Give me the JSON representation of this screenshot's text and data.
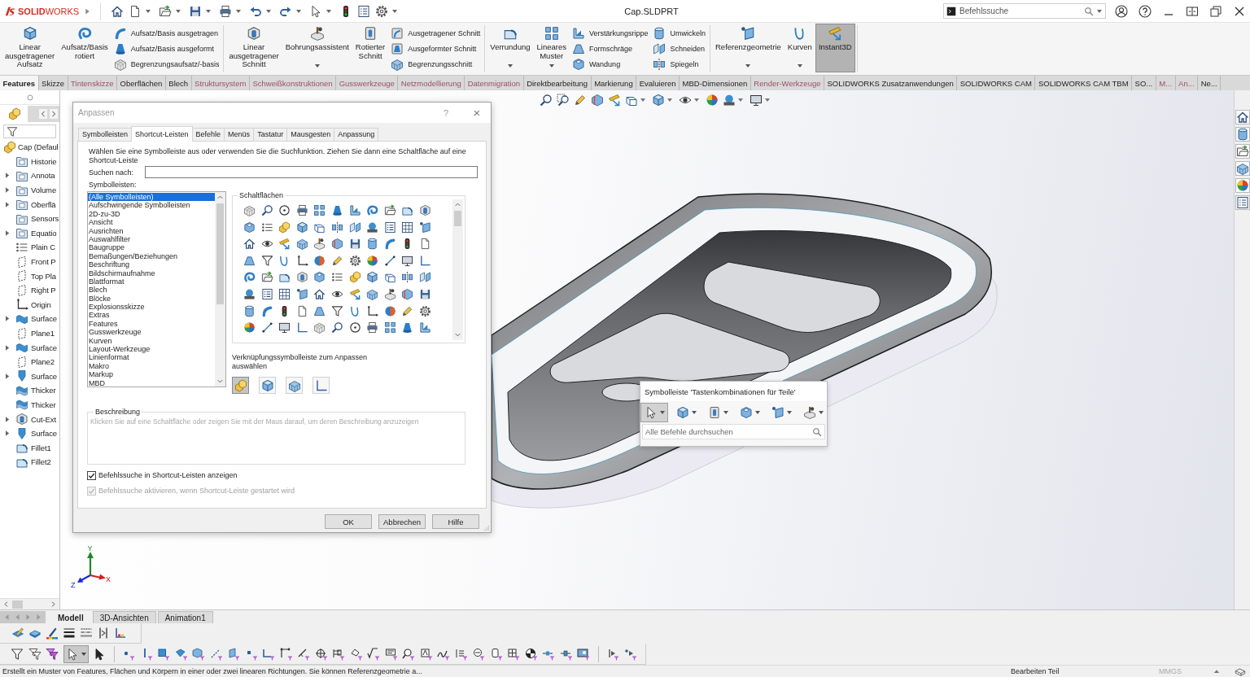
{
  "title_bar": {
    "logo": "**SOLID**WORKS",
    "document_title": "Cap.SLDPRT",
    "command_search": {
      "placeholder": "Befehlssuche"
    }
  },
  "ribbon": {
    "groups": [
      {
        "columns": [
          {
            "kind": "large",
            "label": "Linear\nausgetragener\nAufsatz",
            "dropdown": false,
            "selected": false
          },
          {
            "kind": "large",
            "label": "Aufsatz/Basis\nrotiert",
            "dropdown": false,
            "selected": false
          },
          {
            "kind": "stack",
            "items": [
              "Aufsatz/Basis ausgetragen",
              "Aufsatz/Basis ausgeformt",
              "Begrenzungsaufsatz/-basis"
            ]
          }
        ]
      },
      {
        "columns": [
          {
            "kind": "large",
            "label": "Linear\nausgetragener\nSchnitt",
            "dropdown": false,
            "selected": false
          },
          {
            "kind": "large",
            "label": "Bohrungsassistent",
            "dropdown": true,
            "selected": false
          },
          {
            "kind": "large",
            "label": "Rotierter\nSchnitt",
            "dropdown": false,
            "selected": false
          },
          {
            "kind": "stack",
            "items": [
              "Ausgetragener Schnitt",
              "Ausgeformter Schnitt",
              "Begrenzungsschnitt"
            ]
          }
        ]
      },
      {
        "columns": [
          {
            "kind": "large",
            "label": "Verrundung",
            "dropdown": true,
            "selected": false
          },
          {
            "kind": "large",
            "label": "Lineares\nMuster",
            "dropdown": true,
            "selected": false
          },
          {
            "kind": "stack",
            "items": [
              "Verstärkungsrippe",
              "Formschräge",
              "Wandung"
            ]
          },
          {
            "kind": "stack",
            "items": [
              "Umwickeln",
              "Schneiden",
              "Spiegeln"
            ]
          }
        ]
      },
      {
        "columns": [
          {
            "kind": "large",
            "label": "Referenzgeometrie",
            "dropdown": true,
            "selected": false
          },
          {
            "kind": "large",
            "label": "Kurven",
            "dropdown": true,
            "selected": false
          },
          {
            "kind": "large",
            "label": "Instant3D",
            "dropdown": false,
            "selected": true
          }
        ]
      }
    ]
  },
  "command_tabs": [
    {
      "label": "Features",
      "selected": true,
      "inactive": false
    },
    {
      "label": "Skizze",
      "selected": false,
      "inactive": false
    },
    {
      "label": "Tintenskizze",
      "selected": false,
      "inactive": true
    },
    {
      "label": "Oberflächen",
      "selected": false,
      "inactive": false
    },
    {
      "label": "Blech",
      "selected": false,
      "inactive": false
    },
    {
      "label": "Struktursystem",
      "selected": false,
      "inactive": true
    },
    {
      "label": "Schweißkonstruktionen",
      "selected": false,
      "inactive": true
    },
    {
      "label": "Gusswerkzeuge",
      "selected": false,
      "inactive": true
    },
    {
      "label": "Netzmodellierung",
      "selected": false,
      "inactive": true
    },
    {
      "label": "Datenmigration",
      "selected": false,
      "inactive": true
    },
    {
      "label": "Direktbearbeitung",
      "selected": false,
      "inactive": false
    },
    {
      "label": "Markierung",
      "selected": false,
      "inactive": false
    },
    {
      "label": "Evaluieren",
      "selected": false,
      "inactive": false
    },
    {
      "label": "MBD-Dimensionen",
      "selected": false,
      "inactive": false
    },
    {
      "label": "Render-Werkzeuge",
      "selected": false,
      "inactive": true
    },
    {
      "label": "SOLIDWORKS Zusatzanwendungen",
      "selected": false,
      "inactive": false
    },
    {
      "label": "SOLIDWORKS CAM",
      "selected": false,
      "inactive": false
    },
    {
      "label": "SOLIDWORKS CAM TBM",
      "selected": false,
      "inactive": false
    },
    {
      "label": "SO...",
      "selected": false,
      "inactive": false
    },
    {
      "label": "M...",
      "selected": false,
      "inactive": true
    },
    {
      "label": "An...",
      "selected": false,
      "inactive": true
    },
    {
      "label": "Ne...",
      "selected": false,
      "inactive": false
    }
  ],
  "feature_tree": {
    "root": {
      "label": "Cap (Defaul",
      "children": [
        {
          "label": "Historie",
          "expandable": false
        },
        {
          "label": "Annota",
          "expandable": true
        },
        {
          "label": "Volume",
          "expandable": true
        },
        {
          "label": "Oberflä",
          "expandable": true
        },
        {
          "label": "Sensors",
          "expandable": false
        },
        {
          "label": "Equatio",
          "expandable": true
        },
        {
          "label": "Plain C",
          "expandable": false
        },
        {
          "label": "Front P",
          "expandable": false
        },
        {
          "label": "Top Pla",
          "expandable": false
        },
        {
          "label": "Right P",
          "expandable": false
        },
        {
          "label": "Origin",
          "expandable": false
        },
        {
          "label": "Surface",
          "expandable": true
        },
        {
          "label": "Plane1",
          "expandable": false
        },
        {
          "label": "Surface",
          "expandable": true
        },
        {
          "label": "Plane2",
          "expandable": false
        },
        {
          "label": "Surface",
          "expandable": true
        },
        {
          "label": "Thicker",
          "expandable": false
        },
        {
          "label": "Thicker",
          "expandable": false
        },
        {
          "label": "Cut-Ext",
          "expandable": true
        },
        {
          "label": "Surface",
          "expandable": true
        },
        {
          "label": "Fillet1",
          "expandable": false
        },
        {
          "label": "Fillet2",
          "expandable": false
        }
      ]
    }
  },
  "viewport": {
    "triad": {
      "x_label": "X",
      "y_label": "Y",
      "z_label": "Z"
    }
  },
  "dialog": {
    "title": "Anpassen",
    "help_button": "?",
    "close_button": "×",
    "tabs": [
      {
        "label": "Symbolleisten",
        "selected": false
      },
      {
        "label": "Shortcut-Leisten",
        "selected": true
      },
      {
        "label": "Befehle",
        "selected": false
      },
      {
        "label": "Menüs",
        "selected": false
      },
      {
        "label": "Tastatur",
        "selected": false
      },
      {
        "label": "Mausgesten",
        "selected": false
      },
      {
        "label": "Anpassung",
        "selected": false
      }
    ],
    "instructions": "Wählen Sie eine Symbolleiste aus oder verwenden Sie die Suchfunktion. Ziehen Sie dann eine Schaltfläche auf eine Shortcut-Leiste",
    "search_label": "Suchen nach:",
    "toolbars": {
      "label": "Symbolleisten:",
      "items": [
        {
          "label": "(Alle Symbolleisten)",
          "selected": true
        },
        {
          "label": "Aufschwingende Symbolleisten",
          "selected": false
        },
        {
          "label": "2D-zu-3D",
          "selected": false
        },
        {
          "label": "Ansicht",
          "selected": false
        },
        {
          "label": "Ausrichten",
          "selected": false
        },
        {
          "label": "Auswahlfilter",
          "selected": false
        },
        {
          "label": "Baugruppe",
          "selected": false
        },
        {
          "label": "Bemaßungen/Beziehungen",
          "selected": false
        },
        {
          "label": "Beschriftung",
          "selected": false
        },
        {
          "label": "Bildschirmaufnahme",
          "selected": false
        },
        {
          "label": "Blattformat",
          "selected": false
        },
        {
          "label": "Blech",
          "selected": false
        },
        {
          "label": "Blöcke",
          "selected": false
        },
        {
          "label": "Explosionsskizze",
          "selected": false
        },
        {
          "label": "Extras",
          "selected": false
        },
        {
          "label": "Features",
          "selected": false
        },
        {
          "label": "Gusswerkzeuge",
          "selected": false
        },
        {
          "label": "Kurven",
          "selected": false
        },
        {
          "label": "Layout-Werkzeuge",
          "selected": false
        },
        {
          "label": "Linienformat",
          "selected": false
        },
        {
          "label": "Makro",
          "selected": false
        },
        {
          "label": "Markup",
          "selected": false
        },
        {
          "label": "MBD",
          "selected": false
        }
      ]
    },
    "buttons_group": {
      "label": "Schaltflächen"
    },
    "shortcut_bar": {
      "label": "Verknüpfungssymbolleiste zum Anpassen\nauswählen",
      "options": [
        {
          "selected": true
        },
        {
          "selected": false
        },
        {
          "selected": false
        },
        {
          "selected": false
        }
      ]
    },
    "description": {
      "label": "Beschreibung",
      "text": "Klicken Sie auf eine Schaltfläche oder zeigen Sie mit der Maus darauf, um deren Beschreibung anzuzeigen"
    },
    "checkboxes": [
      {
        "label": "Befehlssuche in Shortcut-Leisten anzeigen",
        "checked": true,
        "disabled": false
      },
      {
        "label": "Befehlssuche aktivieren, wenn Shortcut-Leiste gestartet wird",
        "checked": true,
        "disabled": true
      }
    ],
    "buttons": [
      "OK",
      "Abbrechen",
      "Hilfe"
    ]
  },
  "shortcut_toolbar": {
    "title": "Symbolleiste 'Tastenkombinationen für Teile'",
    "tools": [
      {
        "selected": true
      },
      {
        "selected": false
      },
      {
        "selected": false
      },
      {
        "selected": false
      },
      {
        "selected": false
      },
      {
        "selected": false
      }
    ],
    "search": {
      "placeholder": "Alle Befehle durchsuchen"
    }
  },
  "model_tabs": [
    {
      "label": "Modell",
      "selected": true
    },
    {
      "label": "3D-Ansichten",
      "selected": false
    },
    {
      "label": "Animation1",
      "selected": false
    }
  ],
  "selection_toolbar": {
    "select_button": {
      "selected": true
    }
  },
  "status_bar": {
    "message": "Erstellt ein Muster von Features, Flächen und Körpern in einer oder zwei linearen Richtungen. Sie können Referenzgeometrie a...",
    "mode": "Bearbeiten Teil",
    "units": "MMGS"
  }
}
